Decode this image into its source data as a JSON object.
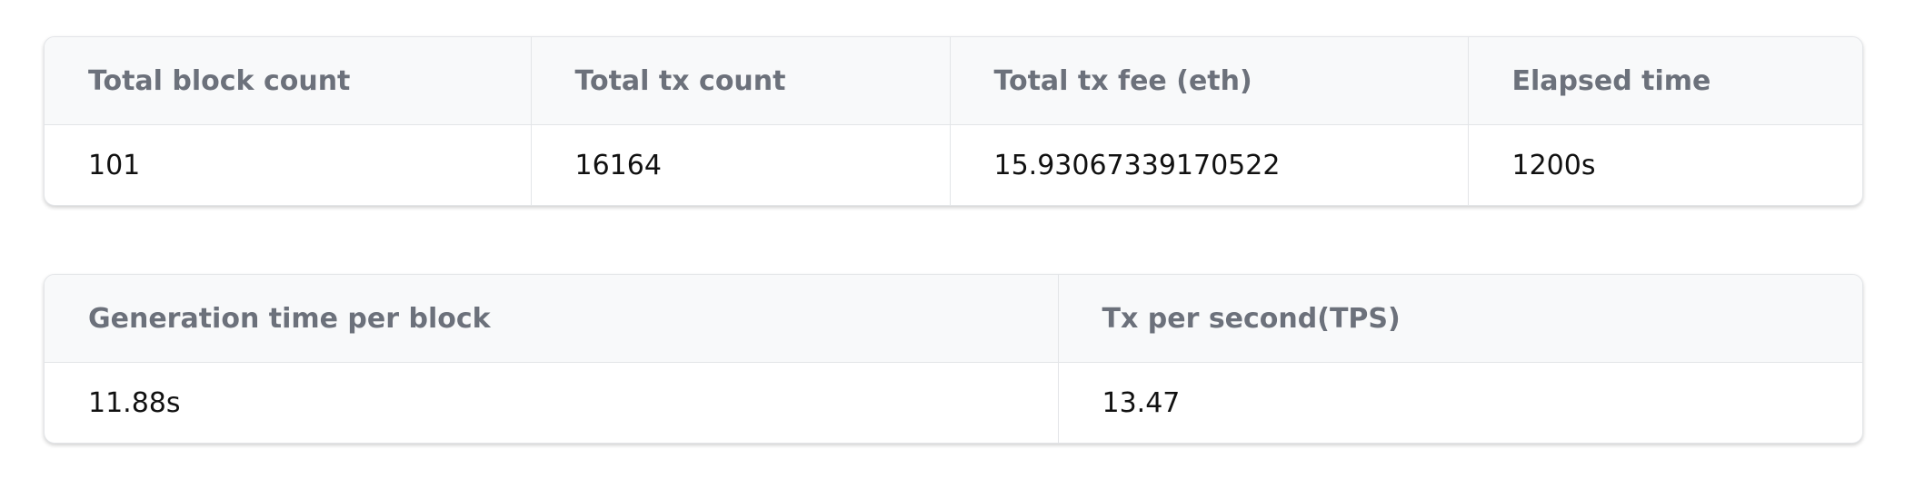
{
  "summary_table": {
    "headers": [
      "Total block count",
      "Total tx count",
      "Total tx fee (eth)",
      "Elapsed time"
    ],
    "values": [
      "101",
      "16164",
      "15.93067339170522",
      "1200s"
    ]
  },
  "rate_table": {
    "headers": [
      "Generation time per block",
      "Tx per second(TPS)"
    ],
    "values": [
      "11.88s",
      "13.47"
    ]
  },
  "colors": {
    "header_bg": "#f8f9fa",
    "header_text": "#6c717b",
    "value_text": "#111111",
    "border": "#e3e5e8"
  }
}
